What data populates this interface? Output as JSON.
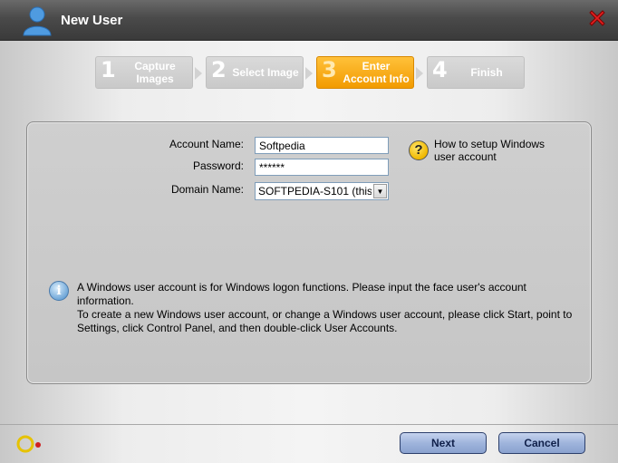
{
  "window": {
    "title": "New User"
  },
  "steps": [
    {
      "number": "1",
      "label": "Capture Images",
      "state": "inactive"
    },
    {
      "number": "2",
      "label": "Select Image",
      "state": "inactive"
    },
    {
      "number": "3",
      "label": "Enter Account Info",
      "state": "active"
    },
    {
      "number": "4",
      "label": "Finish",
      "state": "inactive"
    }
  ],
  "form": {
    "account_name": {
      "label": "Account Name:",
      "value": "Softpedia"
    },
    "password": {
      "label": "Password:",
      "value": "******"
    },
    "domain_name": {
      "label": "Domain Name:",
      "value": "SOFTPEDIA-S101 (this"
    }
  },
  "help": {
    "link_text": "How to setup Windows user account"
  },
  "info": {
    "line1": "A Windows user account is for Windows logon functions. Please input the face user's account information.",
    "line2": "To create a new Windows user account, or change a Windows user account, please click Start, point to Settings, click Control Panel, and then double-click User Accounts."
  },
  "buttons": {
    "next": "Next",
    "cancel": "Cancel"
  },
  "colors": {
    "active_step": "#f29b00",
    "title_bar": "#4a4a4a",
    "button": "#9fb4dc"
  }
}
